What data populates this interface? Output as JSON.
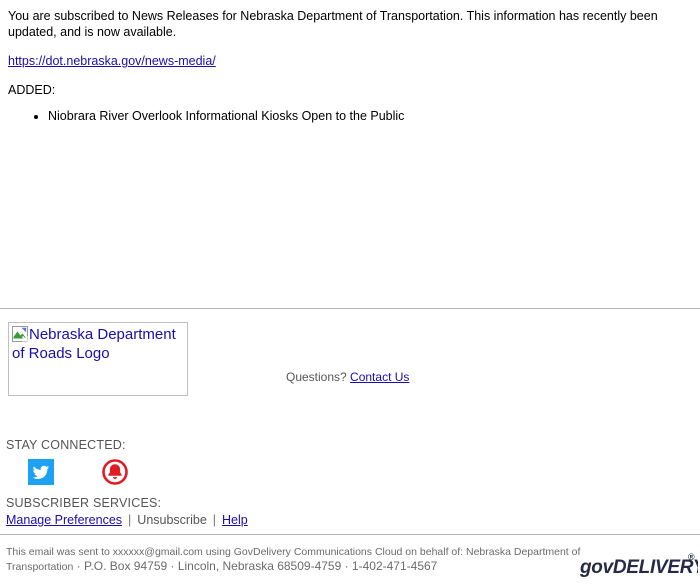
{
  "message": {
    "intro": "You are subscribed to News Releases for Nebraska Department of Transportation. This information has recently been updated, and is now available.",
    "link_text": "https://dot.nebraska.gov/news-media/",
    "added_label": "ADDED:",
    "added_items": [
      "Niobrara River Overlook Informational Kiosks Open to the Public"
    ]
  },
  "footer": {
    "logo_alt": "Nebraska Department of Roads Logo",
    "questions_label": "Questions?",
    "contact_link": "Contact Us",
    "stay_connected_label": "STAY CONNECTED:",
    "social": [
      {
        "name": "twitter-icon",
        "label": "Twitter"
      },
      {
        "name": "bell-icon",
        "label": "Subscribe"
      }
    ],
    "subscriber_services_label": "SUBSCRIBER SERVICES:",
    "manage_preferences": "Manage Preferences",
    "separator": "|",
    "unsubscribe": "Unsubscribe",
    "help": "Help"
  },
  "legal": {
    "line1": "This email was sent to xxxxxx@gmail.com using GovDelivery Communications Cloud on behalf of: Nebraska Department of",
    "line2_prefix": "Transportation",
    "line2_rest": "· P.O. Box 94759 · Lincoln, Nebraska 68509-4759 · 1-402-471-4567",
    "brand": "govDELIVERY"
  },
  "colors": {
    "link": "#1a0dab",
    "muted_text": "#555555",
    "divider": "#b5b5b5",
    "twitter_blue": "#1da1f2",
    "bell_red": "#e01b24",
    "govdelivery_navy": "#262a47"
  }
}
